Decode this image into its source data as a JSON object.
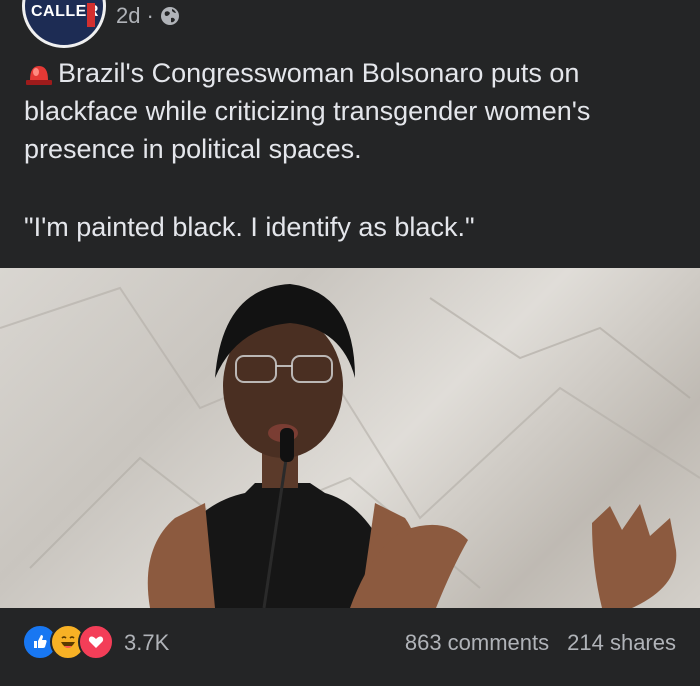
{
  "header": {
    "avatar_text": "CALLER",
    "time": "2d",
    "separator": "·",
    "privacy_icon": "globe-icon"
  },
  "post": {
    "title_emoji": "siren-icon",
    "title": "Brazil's Congresswoman Bolsonaro puts on blackface while criticizing transgender women's presence in political spaces.",
    "quote": "\"I'm painted black. I identify as black.\""
  },
  "reactions": {
    "icons": [
      "like-icon",
      "haha-icon",
      "love-icon"
    ],
    "count": "3.7K",
    "comments": "863 comments",
    "shares": "214 shares"
  },
  "colors": {
    "background": "#242526",
    "text": "#e4e6eb",
    "muted": "#b0b3b8",
    "like": "#1877f2",
    "love": "#f33e58",
    "haha": "#f7b125"
  }
}
